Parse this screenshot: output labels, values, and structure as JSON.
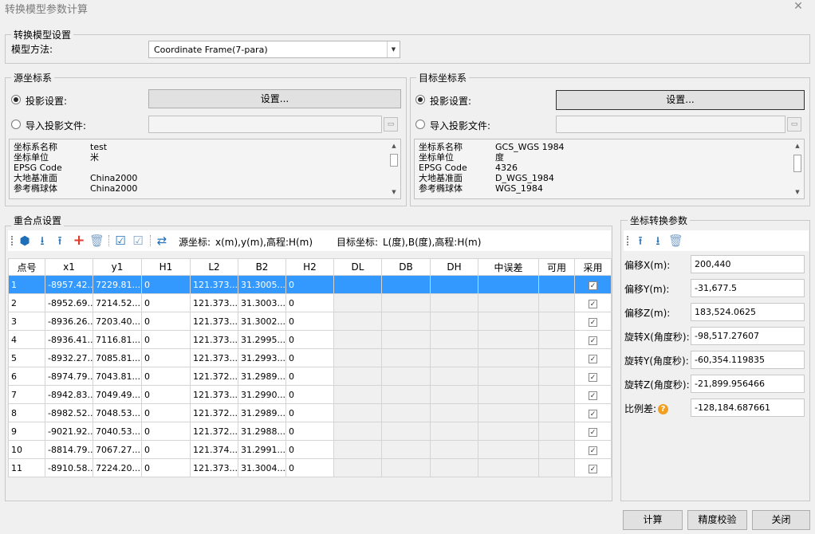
{
  "window": {
    "title": "转换模型参数计算",
    "close_glyph": "✕"
  },
  "model_group": {
    "legend": "转换模型设置",
    "method_label": "模型方法:",
    "method_value": "Coordinate Frame(7-para)"
  },
  "source": {
    "legend": "源坐标系",
    "proj_setting_label": "投影设置:",
    "import_file_label": "导入投影文件:",
    "set_button": "设置...",
    "selected_option": "投影设置",
    "info": [
      {
        "key": "坐标系名称",
        "value": "test"
      },
      {
        "key": "坐标单位",
        "value": "米"
      },
      {
        "key": "EPSG Code",
        "value": ""
      },
      {
        "key": "大地基准面",
        "value": "China2000"
      },
      {
        "key": "参考椭球体",
        "value": "China2000"
      }
    ]
  },
  "target": {
    "legend": "目标坐标系",
    "proj_setting_label": "投影设置:",
    "import_file_label": "导入投影文件:",
    "set_button": "设置...",
    "selected_option": "投影设置",
    "info": [
      {
        "key": "坐标系名称",
        "value": "GCS_WGS 1984"
      },
      {
        "key": "坐标单位",
        "value": "度"
      },
      {
        "key": "EPSG Code",
        "value": "4326"
      },
      {
        "key": "大地基准面",
        "value": "D_WGS_1984"
      },
      {
        "key": "参考椭球体",
        "value": "WGS_1984"
      }
    ]
  },
  "points": {
    "legend": "重合点设置",
    "source_coord_label": "源坐标:",
    "source_coord_value": "x(m),y(m),高程:H(m)",
    "target_coord_label": "目标坐标:",
    "target_coord_value": "L(度),B(度),高程:H(m)",
    "columns": [
      "点号",
      "x1",
      "y1",
      "H1",
      "L2",
      "B2",
      "H2",
      "DL",
      "DB",
      "DH",
      "中误差",
      "可用",
      "采用"
    ],
    "rows": [
      [
        "1",
        "-8957.42...",
        "7229.81...",
        "0",
        "121.373...",
        "31.3005...",
        "0"
      ],
      [
        "2",
        "-8952.69...",
        "7214.52...",
        "0",
        "121.373...",
        "31.3003...",
        "0"
      ],
      [
        "3",
        "-8936.26...",
        "7203.40...",
        "0",
        "121.373...",
        "31.3002...",
        "0"
      ],
      [
        "4",
        "-8936.41...",
        "7116.81...",
        "0",
        "121.373...",
        "31.2995...",
        "0"
      ],
      [
        "5",
        "-8932.27...",
        "7085.81...",
        "0",
        "121.373...",
        "31.2993...",
        "0"
      ],
      [
        "6",
        "-8974.79...",
        "7043.81...",
        "0",
        "121.372...",
        "31.2989...",
        "0"
      ],
      [
        "7",
        "-8942.83...",
        "7049.49...",
        "0",
        "121.373...",
        "31.2990...",
        "0"
      ],
      [
        "8",
        "-8982.52...",
        "7048.53...",
        "0",
        "121.372...",
        "31.2989...",
        "0"
      ],
      [
        "9",
        "-9021.92...",
        "7040.53...",
        "0",
        "121.372...",
        "31.2988...",
        "0"
      ],
      [
        "10",
        "-8814.79...",
        "7067.27...",
        "0",
        "121.374...",
        "31.2991...",
        "0"
      ],
      [
        "11",
        "-8910.58...",
        "7224.20...",
        "0",
        "121.373...",
        "31.3004...",
        "0"
      ]
    ],
    "check_glyph": "✓"
  },
  "params": {
    "legend": "坐标转换参数",
    "items": [
      {
        "label": "偏移X(m):",
        "value": "200,440"
      },
      {
        "label": "偏移Y(m):",
        "value": "-31,677.5"
      },
      {
        "label": "偏移Z(m):",
        "value": "183,524.0625"
      },
      {
        "label": "旋转X(角度秒):",
        "value": "-98,517.27607"
      },
      {
        "label": "旋转Y(角度秒):",
        "value": "-60,354.119835"
      },
      {
        "label": "旋转Z(角度秒):",
        "value": "-21,899.956466"
      },
      {
        "label": "比例差:",
        "value": "-128,184.687661"
      }
    ],
    "help_glyph": "?"
  },
  "footer": {
    "compute": "计算",
    "verify": "精度校验",
    "close": "关闭"
  },
  "colors": {
    "selection": "#3399ff",
    "icon_blue": "#1e6fb8",
    "icon_red": "#e03a2b",
    "help_orange": "#f0a020"
  }
}
